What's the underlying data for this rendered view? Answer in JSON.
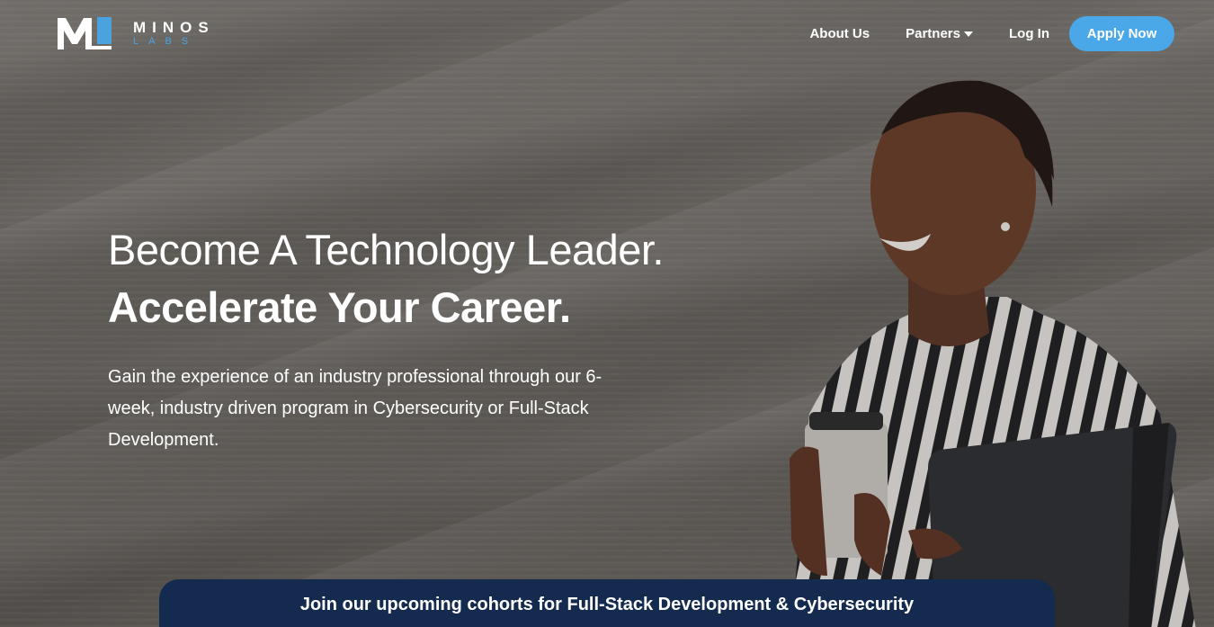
{
  "brand": {
    "mark_letter": "M",
    "name_top": "MINOS",
    "name_bottom": "LABS",
    "accent_color": "#4aa3df"
  },
  "nav": {
    "about_label": "About Us",
    "partners_label": "Partners",
    "login_label": "Log In",
    "apply_label": "Apply Now",
    "apply_color": "#4aa8e8"
  },
  "hero": {
    "headline_line1": "Become A Technology Leader.",
    "headline_line2": "Accelerate Your Career.",
    "subtext": "Gain the experience of an industry professional through our 6-week, industry driven program in Cybersecurity or Full-Stack Development."
  },
  "banner": {
    "text": "Join our upcoming cohorts for Full-Stack Development & Cybersecurity",
    "background_color": "#142a4e"
  },
  "icons": {
    "partners_dropdown": "caret-down-icon"
  }
}
